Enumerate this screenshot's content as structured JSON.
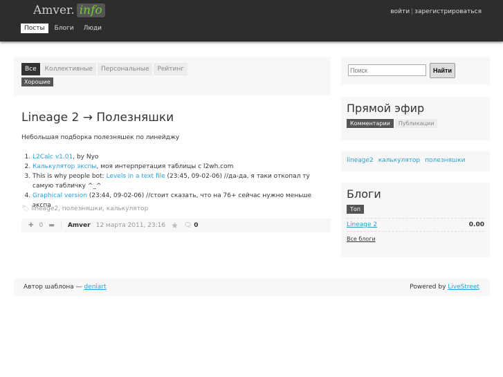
{
  "header": {
    "logo_main": "Amver.",
    "logo_accent": "info",
    "nav": [
      "Посты",
      "Блоги",
      "Люди"
    ],
    "login": "войти",
    "register": "зарегистрироваться"
  },
  "filters": {
    "tabs": [
      "Все",
      "Коллективные",
      "Персональные",
      "Рейтинг"
    ],
    "sub": "Хорошие"
  },
  "post": {
    "blog": "Lineage 2",
    "arrow": "→",
    "title": "Полезняшки",
    "intro": "Небольшая подборка полезняшек по линейджу",
    "items": [
      {
        "link": "L2Calc v1.01",
        "text": ", by Nyo",
        "pre": ""
      },
      {
        "link": "Калькулятор экспы",
        "text": ", моя интерпретация таблицы с l2wh.com",
        "pre": ""
      },
      {
        "pre": "This is why people bot: ",
        "link": "Levels in a text file",
        "text": " (23:45, 09-02-06) //да-да, я таки откопал ту самую табличку ^_^"
      },
      {
        "link": "Graphical version",
        "text": " (23:44, 09-02-06) //стоит сказать, что на 76+ сейчас нужно меньше экспа",
        "pre": ""
      }
    ],
    "tags": "lineage2, полезняшки, калькулятор",
    "votes": "0",
    "author": "Amver",
    "date": "12 марта 2011, 23:16",
    "comments": "0"
  },
  "sidebar": {
    "search_placeholder": "Поиск",
    "search_button": "Найти",
    "live_title": "Прямой эфир",
    "live_tabs": [
      "Комментарии",
      "Публикации"
    ],
    "tag_cloud": [
      "lineage2",
      "калькулятор",
      "полезняшки"
    ],
    "blogs_title": "Блоги",
    "blogs_tab": "Топ",
    "blog_name": "Lineage 2",
    "blog_rating": "0.00",
    "all_blogs": "Все блоги"
  },
  "footer": {
    "author_label": "Автор шаблона — ",
    "author_link": "deniart",
    "powered_label": "Powered by ",
    "powered_link": "LiveStreet"
  }
}
